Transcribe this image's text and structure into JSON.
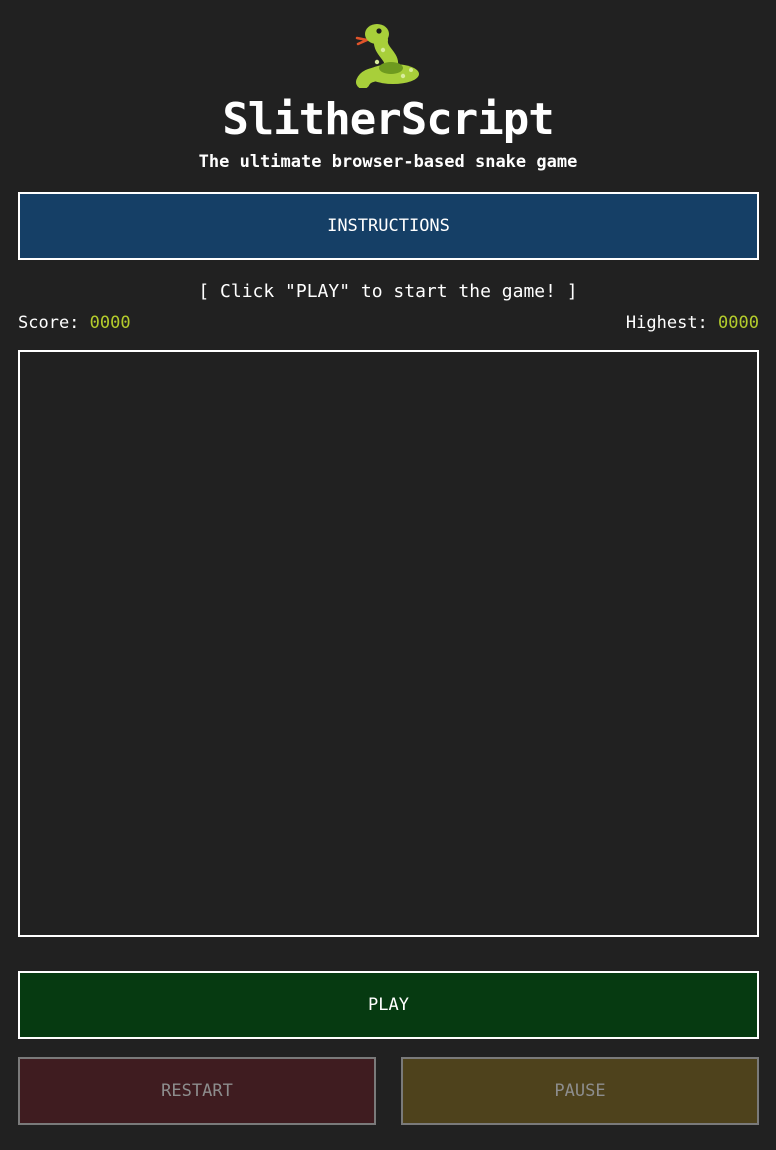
{
  "header": {
    "logo_icon": "snake-icon",
    "title": "SlitherScript",
    "subtitle": "The ultimate browser-based snake game"
  },
  "controls": {
    "instructions_label": "INSTRUCTIONS",
    "play_label": "PLAY",
    "restart_label": "RESTART",
    "pause_label": "PAUSE"
  },
  "status": {
    "hint": "[ Click \"PLAY\" to start the game! ]",
    "score_label": "Score:",
    "score_value": "0000",
    "highest_label": "Highest:",
    "highest_value": "0000"
  },
  "colors": {
    "background": "#212121",
    "instructions_button": "#153f66",
    "play_button": "#063a11",
    "restart_button": "#3f1c20",
    "pause_button": "#4e421c",
    "score_accent": "#b4cc2c"
  }
}
